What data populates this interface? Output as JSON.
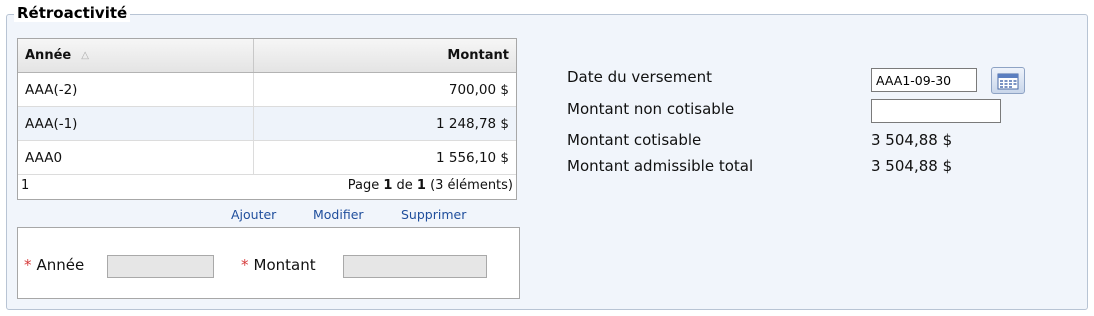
{
  "section": {
    "title": "Rétroactivité"
  },
  "grid": {
    "headers": {
      "year": "Année",
      "amount": "Montant"
    },
    "rows": [
      {
        "year": "AAA(-2)",
        "amount": "700,00 $"
      },
      {
        "year": "AAA(-1)",
        "amount": "1 248,78 $"
      },
      {
        "year": "AAA0",
        "amount": "1 556,10 $"
      }
    ],
    "pager": {
      "left": "1",
      "prefix": "Page ",
      "current": "1",
      "of": " de ",
      "total": "1",
      "suffix": " (3 éléments)"
    }
  },
  "actions": {
    "add": "Ajouter",
    "edit": "Modifier",
    "delete": "Supprimer"
  },
  "form": {
    "required_mark": "*",
    "year_label": "Année",
    "amount_label": "Montant",
    "year_value": "",
    "amount_value": ""
  },
  "details": {
    "payment_date_label": "Date du versement",
    "payment_date_value": "AAA1-09-30",
    "non_contributory_label": "Montant non cotisable",
    "non_contributory_value": "",
    "contributory_label": "Montant cotisable",
    "contributory_value": "3 504,88 $",
    "total_label": "Montant admissible total",
    "total_value": "3 504,88 $"
  },
  "icons": {
    "sort": "sort-ascending-icon",
    "calendar": "calendar-icon"
  },
  "colors": {
    "panel_bg": "#f1f5fb",
    "link": "#1f4e9c",
    "required": "#d63c3c",
    "alt_row": "#eef3fa"
  }
}
